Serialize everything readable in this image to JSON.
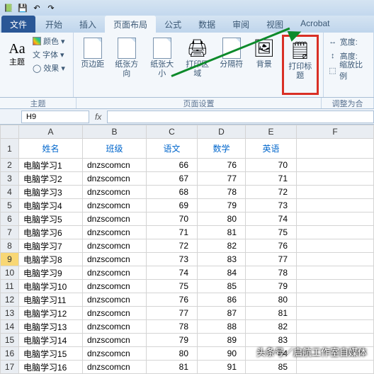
{
  "qat": {
    "save": "💾",
    "undo": "↶",
    "redo": "↷"
  },
  "tabs": {
    "file": "文件",
    "home": "开始",
    "insert": "插入",
    "pagelayout": "页面布局",
    "formulas": "公式",
    "data": "数据",
    "review": "审阅",
    "view": "视图",
    "acrobat": "Acrobat"
  },
  "ribbon": {
    "theme": {
      "label": "主题",
      "colors": "颜色",
      "fonts": "字体",
      "effects": "效果"
    },
    "page": {
      "margins": "页边距",
      "orientation": "纸张方向",
      "size": "纸张大小",
      "printarea": "打印区域",
      "breaks": "分隔符",
      "background": "背景",
      "printtitles": "打印标题"
    },
    "scale": {
      "width": "宽度:",
      "height": "高度:",
      "ratio": "缩放比例"
    },
    "group_theme": "主题",
    "group_page": "页面设置",
    "group_scale": "调整为合"
  },
  "namebox": "H9",
  "fx": "fx",
  "columns": [
    "",
    "A",
    "B",
    "C",
    "D",
    "E",
    "F"
  ],
  "headers": {
    "name": "姓名",
    "class": "班级",
    "chinese": "语文",
    "math": "数学",
    "english": "英语"
  },
  "rows": [
    {
      "n": 1,
      "name": "电脑学习1",
      "cls": "dnzscomcn",
      "c": 66,
      "m": 76,
      "e": 70
    },
    {
      "n": 2,
      "name": "电脑学习2",
      "cls": "dnzscomcn",
      "c": 67,
      "m": 77,
      "e": 71
    },
    {
      "n": 3,
      "name": "电脑学习3",
      "cls": "dnzscomcn",
      "c": 68,
      "m": 78,
      "e": 72
    },
    {
      "n": 4,
      "name": "电脑学习4",
      "cls": "dnzscomcn",
      "c": 69,
      "m": 79,
      "e": 73
    },
    {
      "n": 5,
      "name": "电脑学习5",
      "cls": "dnzscomcn",
      "c": 70,
      "m": 80,
      "e": 74
    },
    {
      "n": 6,
      "name": "电脑学习6",
      "cls": "dnzscomcn",
      "c": 71,
      "m": 81,
      "e": 75
    },
    {
      "n": 7,
      "name": "电脑学习7",
      "cls": "dnzscomcn",
      "c": 72,
      "m": 82,
      "e": 76
    },
    {
      "n": 8,
      "name": "电脑学习8",
      "cls": "dnzscomcn",
      "c": 73,
      "m": 83,
      "e": 77
    },
    {
      "n": 9,
      "name": "电脑学习9",
      "cls": "dnzscomcn",
      "c": 74,
      "m": 84,
      "e": 78
    },
    {
      "n": 10,
      "name": "电脑学习10",
      "cls": "dnzscomcn",
      "c": 75,
      "m": 85,
      "e": 79
    },
    {
      "n": 11,
      "name": "电脑学习11",
      "cls": "dnzscomcn",
      "c": 76,
      "m": 86,
      "e": 80
    },
    {
      "n": 12,
      "name": "电脑学习12",
      "cls": "dnzscomcn",
      "c": 77,
      "m": 87,
      "e": 81
    },
    {
      "n": 13,
      "name": "电脑学习13",
      "cls": "dnzscomcn",
      "c": 78,
      "m": 88,
      "e": 82
    },
    {
      "n": 14,
      "name": "电脑学习14",
      "cls": "dnzscomcn",
      "c": 79,
      "m": 89,
      "e": 83
    },
    {
      "n": 15,
      "name": "电脑学习15",
      "cls": "dnzscomcn",
      "c": 80,
      "m": 90,
      "e": 84
    },
    {
      "n": 16,
      "name": "电脑学习16",
      "cls": "dnzscomcn",
      "c": 81,
      "m": 91,
      "e": 85
    }
  ],
  "selected_row": 9,
  "watermark": "头条号／启航工作室自媒体"
}
